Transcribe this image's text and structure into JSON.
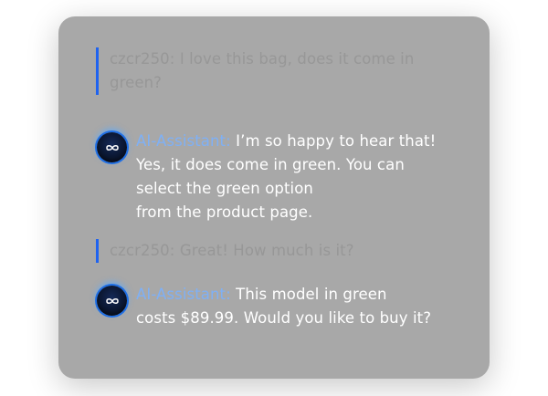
{
  "conversation": {
    "messages": [
      {
        "role": "user",
        "sender": "czcr250:",
        "lines": [
          "I love this bag, does it come in",
          "green?"
        ]
      },
      {
        "role": "assistant",
        "sender": "AI-Assistant:",
        "lines": [
          "I’m so happy to hear that!",
          "Yes, it does come in green. You can",
          "select the green option",
          "from the product page."
        ]
      },
      {
        "role": "user",
        "sender": "czcr250:",
        "lines": [
          "Great! How much is it?"
        ]
      },
      {
        "role": "assistant",
        "sender": "AI-Assistant:",
        "lines": [
          "This model in green",
          "costs $89.99. Would you like to buy it?"
        ]
      }
    ]
  },
  "colors": {
    "card_bg": "#a8a8a8",
    "accent_bar": "#1f63f0",
    "assistant_name": "#7fb0f5",
    "user_text": "#979797",
    "assistant_text": "#ffffff"
  },
  "icons": {
    "assistant_avatar": "infinity-icon"
  }
}
